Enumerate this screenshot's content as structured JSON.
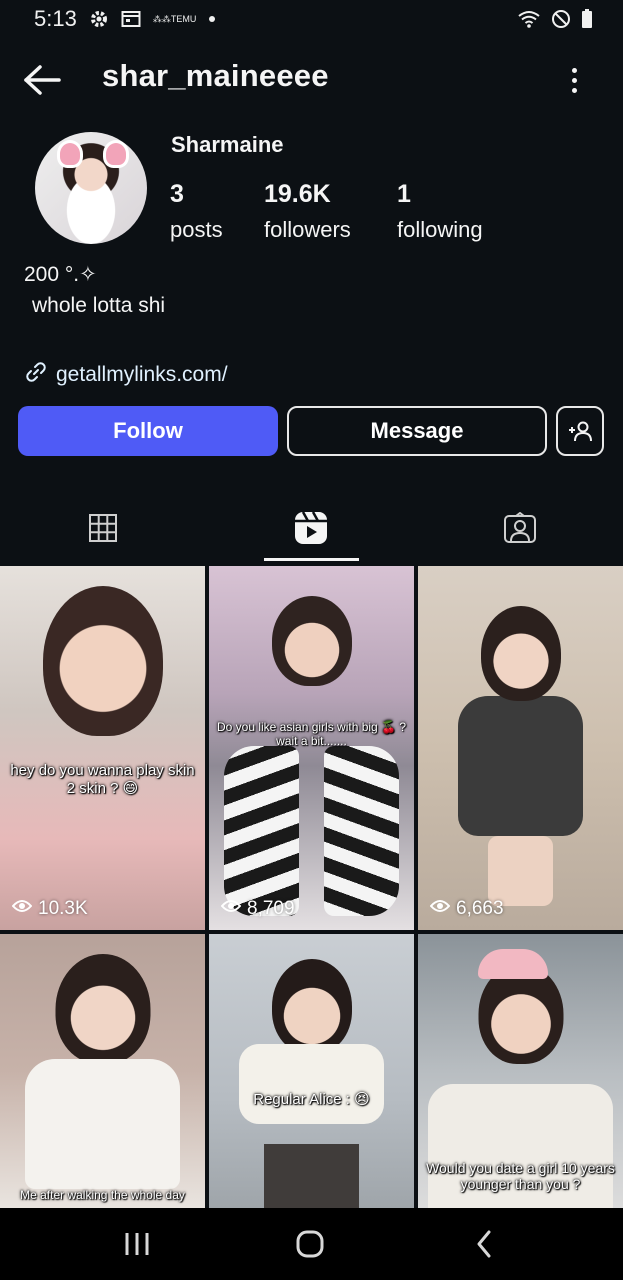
{
  "status_bar": {
    "time": "5:13",
    "temu_label": "TEMU",
    "icons": [
      "gear-icon",
      "calendar-icon",
      "temu-icon",
      "dot-icon",
      "wifi-icon",
      "dnd-icon",
      "battery-icon"
    ]
  },
  "header": {
    "username": "shar_maineeee",
    "back_icon": "back-arrow-icon",
    "more_icon": "more-options-icon"
  },
  "profile": {
    "display_name": "Sharmaine",
    "stats": [
      {
        "value": "3",
        "label": "posts"
      },
      {
        "value": "19.6K",
        "label": "followers"
      },
      {
        "value": "1",
        "label": "following"
      }
    ],
    "bio_line1": "200  °.✧",
    "bio_line2": "whole lotta shi",
    "link": "getallmylinks.com/"
  },
  "actions": {
    "follow": "Follow",
    "message": "Message",
    "add_user_icon": "add-user-icon"
  },
  "tabs": [
    {
      "icon": "grid-icon",
      "active": false
    },
    {
      "icon": "reels-icon",
      "active": true
    },
    {
      "icon": "tagged-icon",
      "active": false
    }
  ],
  "reels": [
    {
      "caption": "hey do you wanna play skin 2 skin ? 😄",
      "views": "10.3K"
    },
    {
      "caption": "Do you like asian girls with big 🍒 ? wait a bit.......",
      "views": "8,709"
    },
    {
      "caption": "",
      "views": "6,663"
    },
    {
      "caption": "Me after walking the whole day",
      "views": ""
    },
    {
      "caption": "Regular Alice : 😣",
      "views": ""
    },
    {
      "caption": "Would you date a girl 10 years younger than you ?",
      "views": ""
    }
  ],
  "colors": {
    "background": "#0c1014",
    "follow_button": "#4f5bf6",
    "text": "#f5f5f5"
  }
}
